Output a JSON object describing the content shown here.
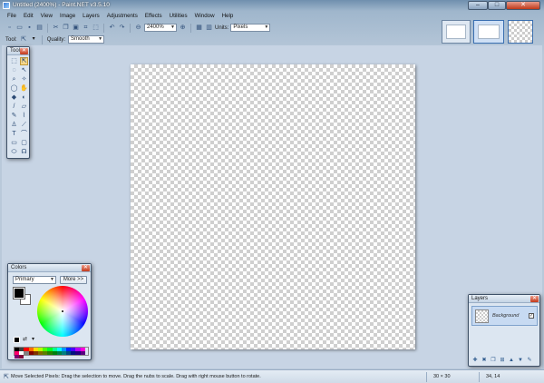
{
  "window": {
    "title": "Untitled (2400%) - Paint.NET v3.5.10",
    "minimize": "–",
    "maximize": "□",
    "close": "✕"
  },
  "menu": [
    "File",
    "Edit",
    "View",
    "Image",
    "Layers",
    "Adjustments",
    "Effects",
    "Utilities",
    "Window",
    "Help"
  ],
  "toolbar": {
    "zoom_value": "2400%",
    "units_label": "Units:",
    "units_value": "Pixels"
  },
  "toolbar2": {
    "tool_label": "Tool:",
    "quality_label": "Quality:",
    "quality_value": "Smooth"
  },
  "tools_panel": {
    "title": "Tools",
    "tools": [
      "move-selection",
      "move-selected",
      "zoom",
      "magic-wand",
      "lasso",
      "paint-bucket",
      "ellipse-select",
      "gradient",
      "paintbrush",
      "eraser",
      "pencil",
      "color-picker",
      "clone-stamp",
      "recolor",
      "text",
      "line",
      "rectangle",
      "rounded-rectangle",
      "ellipse",
      "freeform-shape"
    ]
  },
  "colors_panel": {
    "title": "Colors",
    "mode_value": "Primary",
    "more_label": "More >>",
    "primary_color": "#000000",
    "secondary_color": "#ffffff",
    "palette": [
      "#000000",
      "#404040",
      "#ff0000",
      "#ff6a00",
      "#ffd800",
      "#b6ff00",
      "#4cff00",
      "#00ff21",
      "#00ff90",
      "#00ffff",
      "#0094ff",
      "#0026ff",
      "#4800ff",
      "#b200ff",
      "#ff00dc",
      "#ff006e",
      "#ffffff",
      "#808080",
      "#7f0000",
      "#7f3300",
      "#7f6a00",
      "#5b7f00",
      "#267f00",
      "#007f0e",
      "#007f46",
      "#007f7f",
      "#004a7f",
      "#00137f",
      "#21007f",
      "#57007f",
      "#7f006e",
      "#7f0037"
    ]
  },
  "layers_panel": {
    "title": "Layers",
    "layer_name": "Background",
    "visible": "✓"
  },
  "status": {
    "message": "Move Selected Pixels: Drag the selection to move. Drag the nubs to scale. Drag with right mouse button to rotate.",
    "image_size": "30 × 30",
    "cursor_pos": "34, 14"
  }
}
